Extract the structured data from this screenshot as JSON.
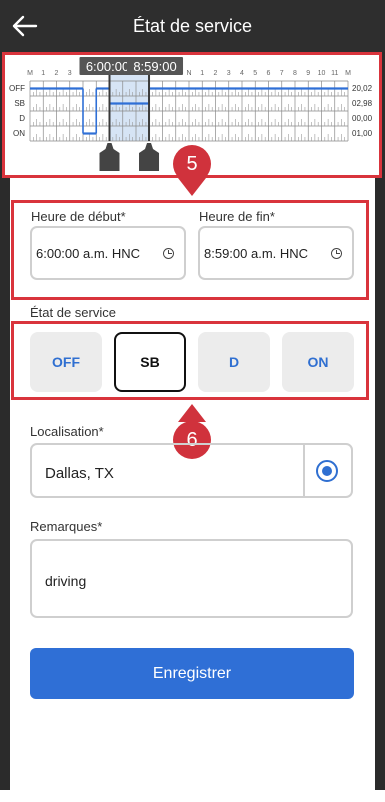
{
  "app": {
    "title": "État de service"
  },
  "log_chart": {
    "row_labels": [
      "OFF",
      "SB",
      "D",
      "ON"
    ],
    "row_totals": [
      "20,02",
      "02,98",
      "00,00",
      "01,00"
    ],
    "hour_labels": [
      "M",
      "1",
      "2",
      "3",
      "4",
      "5",
      "6",
      "7",
      "8",
      "9",
      "10",
      "11",
      "N",
      "1",
      "2",
      "3",
      "4",
      "5",
      "6",
      "7",
      "8",
      "9",
      "10",
      "11",
      "M"
    ],
    "selection_start_label": "6:00:00",
    "selection_end_label": "8:59:00",
    "selection_start_hour": 6,
    "selection_end_hour": 8.983
  },
  "callouts": {
    "first": "5",
    "second": "6"
  },
  "form": {
    "start_label": "Heure de début*",
    "start_value": "6:00:00 a.m. HNC",
    "end_label": "Heure de fin*",
    "end_value": "8:59:00 a.m. HNC",
    "status_label": "État de service",
    "status_options": [
      "OFF",
      "SB",
      "D",
      "ON"
    ],
    "selected_status": "SB",
    "location_label": "Localisation*",
    "location_value": "Dallas, TX",
    "remarks_label": "Remarques*",
    "remarks_value": "driving",
    "save_label": "Enregistrer"
  },
  "colors": {
    "accent": "#2f6fd6",
    "highlight": "#d9343c",
    "appbar": "#2e2e2e"
  }
}
